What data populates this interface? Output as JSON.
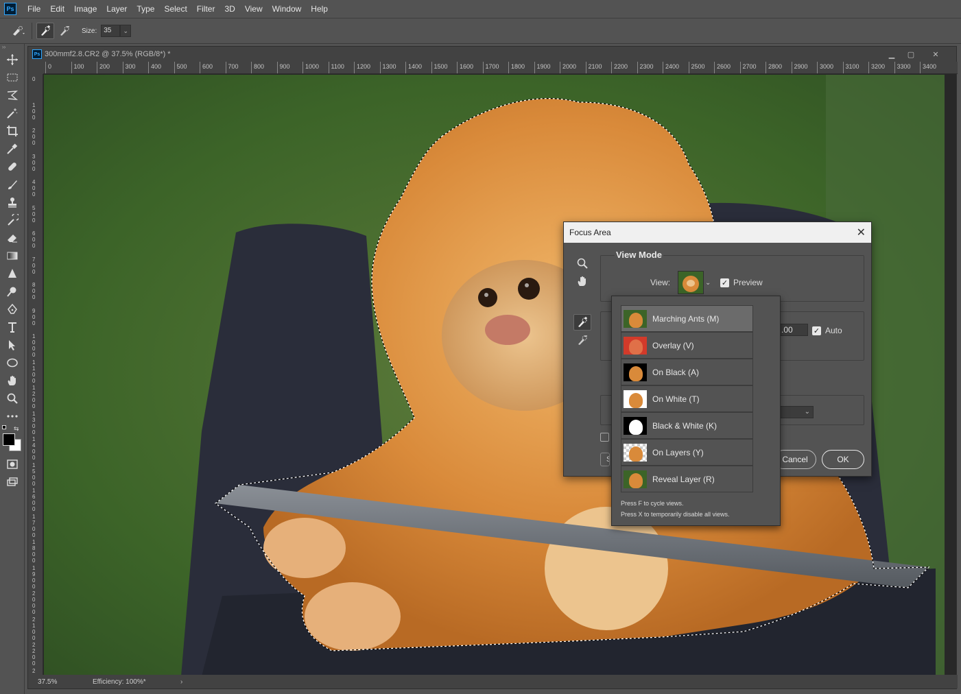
{
  "app": {
    "logo": "Ps"
  },
  "menubar": {
    "items": [
      "File",
      "Edit",
      "Image",
      "Layer",
      "Type",
      "Select",
      "Filter",
      "3D",
      "View",
      "Window",
      "Help"
    ]
  },
  "options": {
    "size_label": "Size:",
    "size_value": "35"
  },
  "document": {
    "tab_title": "300mmf2.8.CR2 @ 37.5% (RGB/8*) *",
    "ruler_top": [
      "0",
      "100",
      "200",
      "300",
      "400",
      "500",
      "600",
      "700",
      "800",
      "900",
      "1000",
      "1100",
      "1200",
      "1300",
      "1400",
      "1500",
      "1600",
      "1700",
      "1800",
      "1900",
      "2000",
      "2100",
      "2200",
      "2300",
      "2400",
      "2500",
      "2600",
      "2700",
      "2800",
      "2900",
      "3000",
      "3100",
      "3200",
      "3300",
      "3400"
    ],
    "ruler_left": [
      "0",
      "100",
      "200",
      "300",
      "400",
      "500",
      "600",
      "700",
      "800",
      "900",
      "1000",
      "1100",
      "1200",
      "1300",
      "1400",
      "1500",
      "1600",
      "1700",
      "1800",
      "1900",
      "2000",
      "2100",
      "2200",
      "2300"
    ],
    "zoom": "37.5%",
    "efficiency": "Efficiency: 100%*",
    "status_arrow": "›"
  },
  "dialog": {
    "title": "Focus Area",
    "view_mode_label": "View Mode",
    "view_label": "View:",
    "preview_label": "Preview",
    "param_value": ".00",
    "auto_label": "Auto",
    "cancel_label": "Cancel",
    "ok_label": "OK",
    "partial_letter_1": "S",
    "partial_letter_2": "S"
  },
  "view_menu": {
    "items": [
      {
        "label": "Marching Ants (M)",
        "icon": "marching-ants-thumb",
        "selected": true
      },
      {
        "label": "Overlay (V)",
        "icon": "overlay-thumb"
      },
      {
        "label": "On Black (A)",
        "icon": "on-black-thumb"
      },
      {
        "label": "On White (T)",
        "icon": "on-white-thumb"
      },
      {
        "label": "Black & White (K)",
        "icon": "black-white-thumb"
      },
      {
        "label": "On Layers (Y)",
        "icon": "on-layers-thumb"
      },
      {
        "label": "Reveal Layer (R)",
        "icon": "reveal-layer-thumb"
      }
    ],
    "hint_1": "Press F to cycle views.",
    "hint_2": "Press X to temporarily disable all views."
  },
  "colors": {
    "fur": "#d98a3a",
    "background_green": "#3f6a2a",
    "chair": "#2a2d3a",
    "ps_blue": "#31a8ff"
  }
}
